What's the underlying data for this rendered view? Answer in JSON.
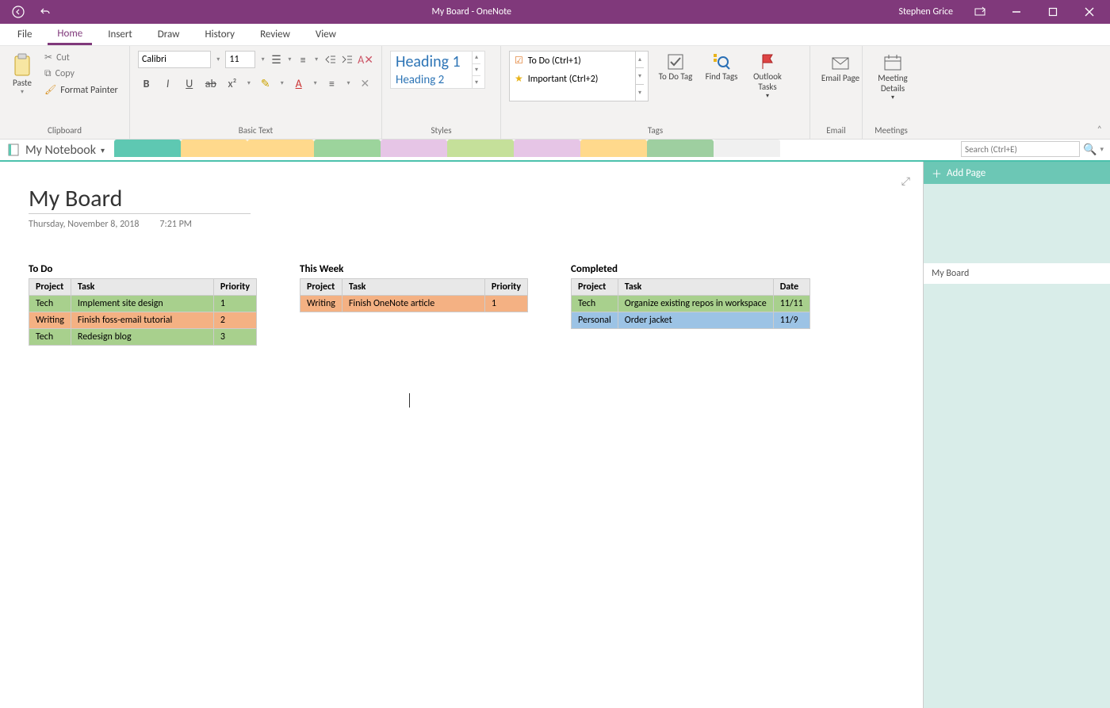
{
  "title": "My Board  -  OneNote",
  "user": "Stephen Grice",
  "menu": {
    "file": "File",
    "home": "Home",
    "insert": "Insert",
    "draw": "Draw",
    "history": "History",
    "review": "Review",
    "view": "View"
  },
  "clipboard": {
    "paste": "Paste",
    "cut": "Cut",
    "copy": "Copy",
    "fmt": "Format Painter",
    "label": "Clipboard"
  },
  "basictext": {
    "font": "Calibri",
    "size": "11",
    "label": "Basic Text"
  },
  "styles": {
    "h1": "Heading 1",
    "h2": "Heading 2",
    "label": "Styles"
  },
  "tags": {
    "todo": "To Do (Ctrl+1)",
    "important": "Important (Ctrl+2)",
    "todobtn": "To Do Tag",
    "findbtn": "Find Tags",
    "outlookbtn": "Outlook Tasks",
    "label": "Tags"
  },
  "email": {
    "btn": "Email Page",
    "label": "Email"
  },
  "meetings": {
    "btn": "Meeting Details",
    "label": "Meetings"
  },
  "notebook": "My Notebook",
  "search_ph": "Search (Ctrl+E)",
  "addpage": "Add Page",
  "pageitem": "My Board",
  "page": {
    "title": "My Board",
    "date": "Thursday, November 8, 2018",
    "time": "7:21 PM"
  },
  "boards": {
    "todo": {
      "title": "To Do",
      "cols": [
        "Project",
        "Task",
        "Priority"
      ],
      "rows": [
        {
          "c": [
            "Tech",
            "Implement site design",
            "1"
          ],
          "color": "green"
        },
        {
          "c": [
            "Writing",
            "Finish foss-email tutorial",
            "2"
          ],
          "color": "orange"
        },
        {
          "c": [
            "Tech",
            "Redesign blog",
            "3"
          ],
          "color": "green"
        }
      ]
    },
    "week": {
      "title": "This Week",
      "cols": [
        "Project",
        "Task",
        "Priority"
      ],
      "rows": [
        {
          "c": [
            "Writing",
            "Finish OneNote article",
            "1"
          ],
          "color": "orange"
        }
      ]
    },
    "done": {
      "title": "Completed",
      "cols": [
        "Project",
        "Task",
        "Date"
      ],
      "rows": [
        {
          "c": [
            "Tech",
            "Organize existing repos in workspace",
            "11/11"
          ],
          "color": "green"
        },
        {
          "c": [
            "Personal",
            "Order jacket",
            "11/9"
          ],
          "color": "blue"
        }
      ]
    }
  },
  "sectioncolors": [
    "#5ec8b2",
    "#ffd98c",
    "#ffd98c",
    "#9cd49c",
    "#e6c5e6",
    "#c5e09a",
    "#e6c5e6",
    "#ffd98c",
    "#9ecfa0",
    "#f0f0f0"
  ]
}
